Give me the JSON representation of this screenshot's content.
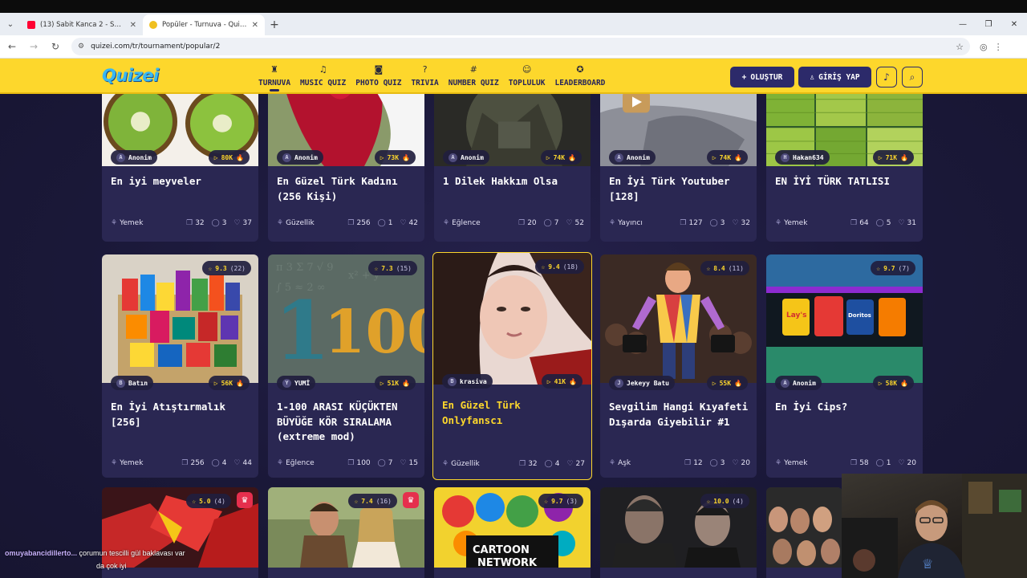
{
  "browser": {
    "tabs": [
      {
        "title": "(13) Sabit Kanca 2 - Sensin Ada...",
        "favicon": "youtube-icon",
        "active": false
      },
      {
        "title": "Popüler - Turnuva - Quizei",
        "favicon": "quizei-icon",
        "active": true
      }
    ],
    "new_tab": "+",
    "url": "quizei.com/tr/tournament/popular/2"
  },
  "site": {
    "logo": "Quizei",
    "nav": [
      {
        "label": "TURNUVA",
        "icon": "trophy-icon",
        "glyph": "♜",
        "active": true
      },
      {
        "label": "MUSIC QUIZ",
        "icon": "music-icon",
        "glyph": "♫",
        "active": false
      },
      {
        "label": "PHOTO QUIZ",
        "icon": "camera-icon",
        "glyph": "◙",
        "active": false
      },
      {
        "label": "TRIVIA",
        "icon": "question-icon",
        "glyph": "?",
        "active": false
      },
      {
        "label": "NUMBER QUIZ",
        "icon": "hash-icon",
        "glyph": "#",
        "active": false
      },
      {
        "label": "TOPLULUK",
        "icon": "community-icon",
        "glyph": "☺",
        "active": false
      },
      {
        "label": "LEADERBOARD",
        "icon": "medal-icon",
        "glyph": "✪",
        "active": false
      }
    ],
    "create_label": "OLUŞTUR",
    "login_label": "GİRİŞ YAP"
  },
  "cards_row1": [
    {
      "author": "Anonim",
      "author_initial": "A",
      "views": "80K",
      "title": "En iyi meyveler",
      "category": "Yemek",
      "questions": "32",
      "comments": "3",
      "likes": "37"
    },
    {
      "author": "Anonim",
      "author_initial": "A",
      "views": "73K",
      "title": "En Güzel Türk Kadını (256 Kişi)",
      "category": "Güzellik",
      "questions": "256",
      "comments": "1",
      "likes": "42"
    },
    {
      "author": "Anonim",
      "author_initial": "A",
      "views": "74K",
      "title": "1 Dilek Hakkım Olsa",
      "category": "Eğlence",
      "questions": "20",
      "comments": "7",
      "likes": "52"
    },
    {
      "author": "Anonim",
      "author_initial": "A",
      "views": "74K",
      "title": "En İyi Türk Youtuber [128]",
      "category": "Yayıncı",
      "questions": "127",
      "comments": "3",
      "likes": "32"
    },
    {
      "author": "Hakan634",
      "author_initial": "H",
      "views": "71K",
      "title": "EN İYİ TÜRK TATLISI",
      "category": "Yemek",
      "questions": "64",
      "comments": "5",
      "likes": "31"
    }
  ],
  "cards_row2": [
    {
      "rating": "9.3",
      "rating_count": "(22)",
      "author": "Batın",
      "author_initial": "B",
      "views": "56K",
      "title": "En İyi Atıştırmalık [256]",
      "category": "Yemek",
      "questions": "256",
      "comments": "4",
      "likes": "44"
    },
    {
      "rating": "7.3",
      "rating_count": "(15)",
      "author": "YUMİ",
      "author_initial": "Y",
      "views": "51K",
      "title": "1-100 ARASI KÜÇÜKTEN BÜYÜĞE KÖR SIRALAMA (extreme mod)",
      "category": "Eğlence",
      "questions": "100",
      "comments": "7",
      "likes": "15"
    },
    {
      "rating": "9.4",
      "rating_count": "(18)",
      "author": "krasiva",
      "author_initial": "B",
      "views": "41K",
      "title": "En Güzel Türk Onlyfanscı",
      "category": "Güzellik",
      "questions": "32",
      "comments": "4",
      "likes": "27"
    },
    {
      "rating": "8.4",
      "rating_count": "(11)",
      "author": "Jekeyy Batu",
      "author_initial": "J",
      "views": "55K",
      "title": "Sevgilim Hangi Kıyafeti Dışarda Giyebilir #1",
      "category": "Aşk",
      "questions": "12",
      "comments": "3",
      "likes": "20"
    },
    {
      "rating": "9.7",
      "rating_count": "(7)",
      "author": "Anonim",
      "author_initial": "A",
      "views": "58K",
      "title": "En İyi Cips?",
      "category": "Yemek",
      "questions": "58",
      "comments": "1",
      "likes": "20"
    }
  ],
  "cards_row3": [
    {
      "rating": "5.0",
      "rating_count": "(4)",
      "premium": true
    },
    {
      "rating": "7.4",
      "rating_count": "(16)",
      "premium": true
    },
    {
      "rating": "9.7",
      "rating_count": "(3)",
      "premium": false
    },
    {
      "rating": "10.0",
      "rating_count": "(4)",
      "premium": false
    },
    {
      "rating": "",
      "rating_count": "",
      "premium": false
    }
  ],
  "overlay": {
    "chat_user": "omuyabancidillerto...",
    "chat_line1": "çorumun tescilli gül baklavası var",
    "chat_line2": "da çok iyi"
  },
  "colors": {
    "brand_yellow": "#fdd72c",
    "header_button": "#2c2a6a",
    "card_bg": "#2a2752",
    "page_bg": "#1b1838",
    "premium_red": "#e52f4d"
  }
}
